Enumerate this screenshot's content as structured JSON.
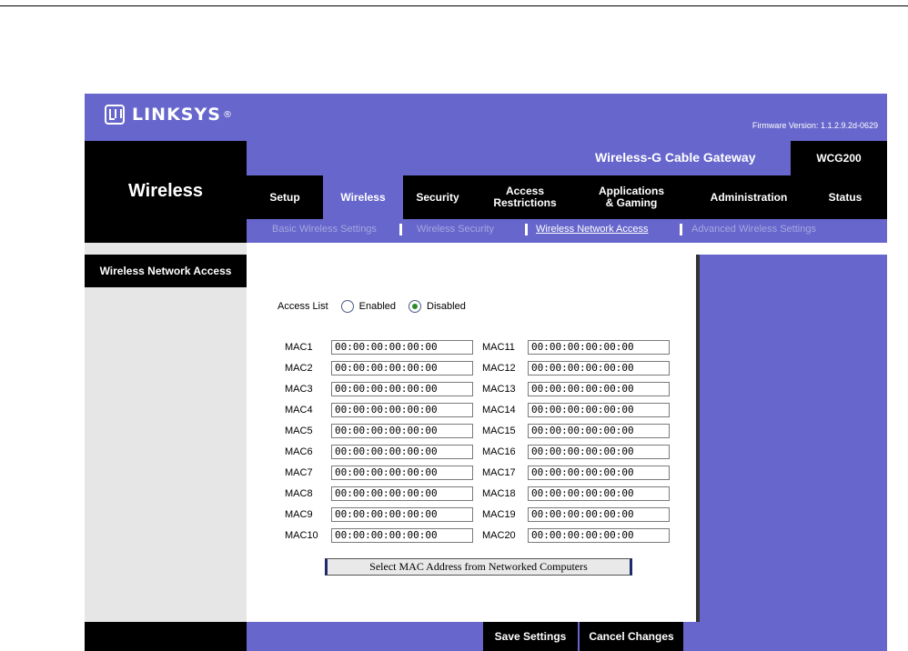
{
  "header": {
    "brand": "LINKSYS",
    "registered_mark": "®",
    "firmware": "Firmware Version: 1.1.2.9.2d-0629",
    "product_name": "Wireless-G Cable Gateway",
    "model": "WCG200"
  },
  "section_title": "Wireless",
  "tabs": [
    {
      "label": "Setup"
    },
    {
      "label": "Wireless"
    },
    {
      "label": "Security"
    },
    {
      "label": "Access\nRestrictions"
    },
    {
      "label": "Applications\n& Gaming"
    },
    {
      "label": "Administration"
    },
    {
      "label": "Status"
    }
  ],
  "subnav": [
    {
      "label": "Basic Wireless Settings"
    },
    {
      "label": "Wireless Security"
    },
    {
      "label": "Wireless Network Access"
    },
    {
      "label": "Advanced Wireless Settings"
    }
  ],
  "sidebar": {
    "heading": "Wireless Network Access"
  },
  "access_list": {
    "label": "Access List",
    "enabled_label": "Enabled",
    "disabled_label": "Disabled",
    "selected": "Disabled"
  },
  "mac_left": [
    {
      "label": "MAC1",
      "value": "00:00:00:00:00:00"
    },
    {
      "label": "MAC2",
      "value": "00:00:00:00:00:00"
    },
    {
      "label": "MAC3",
      "value": "00:00:00:00:00:00"
    },
    {
      "label": "MAC4",
      "value": "00:00:00:00:00:00"
    },
    {
      "label": "MAC5",
      "value": "00:00:00:00:00:00"
    },
    {
      "label": "MAC6",
      "value": "00:00:00:00:00:00"
    },
    {
      "label": "MAC7",
      "value": "00:00:00:00:00:00"
    },
    {
      "label": "MAC8",
      "value": "00:00:00:00:00:00"
    },
    {
      "label": "MAC9",
      "value": "00:00:00:00:00:00"
    },
    {
      "label": "MAC10",
      "value": "00:00:00:00:00:00"
    }
  ],
  "mac_right": [
    {
      "label": "MAC11",
      "value": "00:00:00:00:00:00"
    },
    {
      "label": "MAC12",
      "value": "00:00:00:00:00:00"
    },
    {
      "label": "MAC13",
      "value": "00:00:00:00:00:00"
    },
    {
      "label": "MAC14",
      "value": "00:00:00:00:00:00"
    },
    {
      "label": "MAC15",
      "value": "00:00:00:00:00:00"
    },
    {
      "label": "MAC16",
      "value": "00:00:00:00:00:00"
    },
    {
      "label": "MAC17",
      "value": "00:00:00:00:00:00"
    },
    {
      "label": "MAC18",
      "value": "00:00:00:00:00:00"
    },
    {
      "label": "MAC19",
      "value": "00:00:00:00:00:00"
    },
    {
      "label": "MAC20",
      "value": "00:00:00:00:00:00"
    }
  ],
  "select_mac_button": "Select MAC Address from Networked Computers",
  "footer": {
    "save_label": "Save Settings",
    "cancel_label": "Cancel Changes"
  },
  "colors": {
    "brand_purple": "#6666cc",
    "nav_black": "#000000",
    "sidebar_gray": "#e6e6e6"
  }
}
